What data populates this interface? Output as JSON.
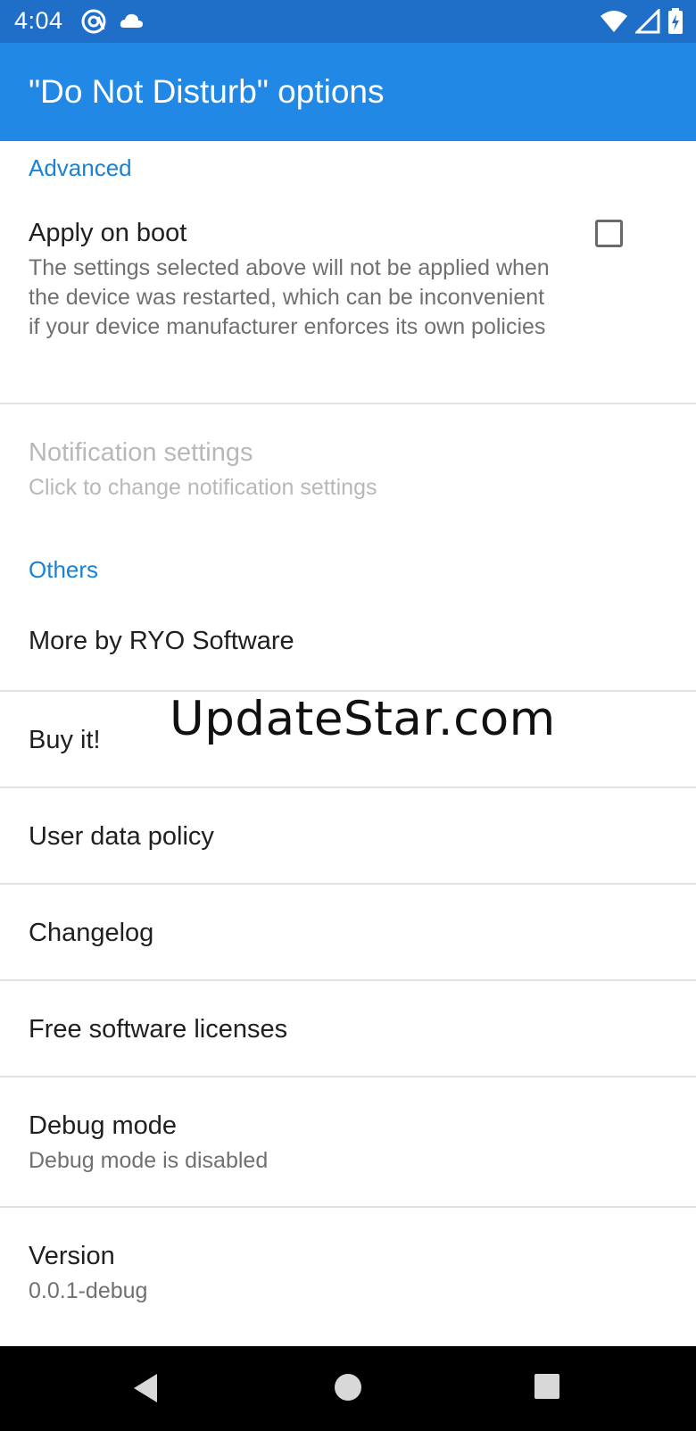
{
  "status_bar": {
    "time": "4:04",
    "left_icons": [
      "at-sign-icon",
      "cloud-icon"
    ],
    "right_icons": [
      "wifi-icon",
      "cell-signal-icon",
      "battery-charging-icon"
    ]
  },
  "app_bar": {
    "title": "\"Do Not Disturb\" options",
    "color": "#2188e6"
  },
  "sections": {
    "advanced": {
      "header": "Advanced",
      "apply_on_boot": {
        "title": "Apply on boot",
        "summary": "The settings selected above will not be applied when the device was restarted, which can be inconvenient if your device manufacturer enforces its own policies",
        "checked": false
      },
      "notification_settings": {
        "title": "Notification settings",
        "summary": "Click to change notification settings",
        "enabled": false
      }
    },
    "others": {
      "header": "Others",
      "more_by": {
        "title": "More by RYO Software"
      },
      "buy_it": {
        "title": "Buy it!"
      },
      "user_data_policy": {
        "title": "User data policy"
      },
      "changelog": {
        "title": "Changelog"
      },
      "licenses": {
        "title": "Free software licenses"
      },
      "debug_mode": {
        "title": "Debug mode",
        "summary": "Debug mode is disabled"
      },
      "version": {
        "title": "Version",
        "summary": "0.0.1-debug"
      }
    }
  },
  "watermark": "UpdateStar.com",
  "nav_bar": {
    "buttons": [
      "back-icon",
      "home-icon",
      "recents-icon"
    ]
  }
}
